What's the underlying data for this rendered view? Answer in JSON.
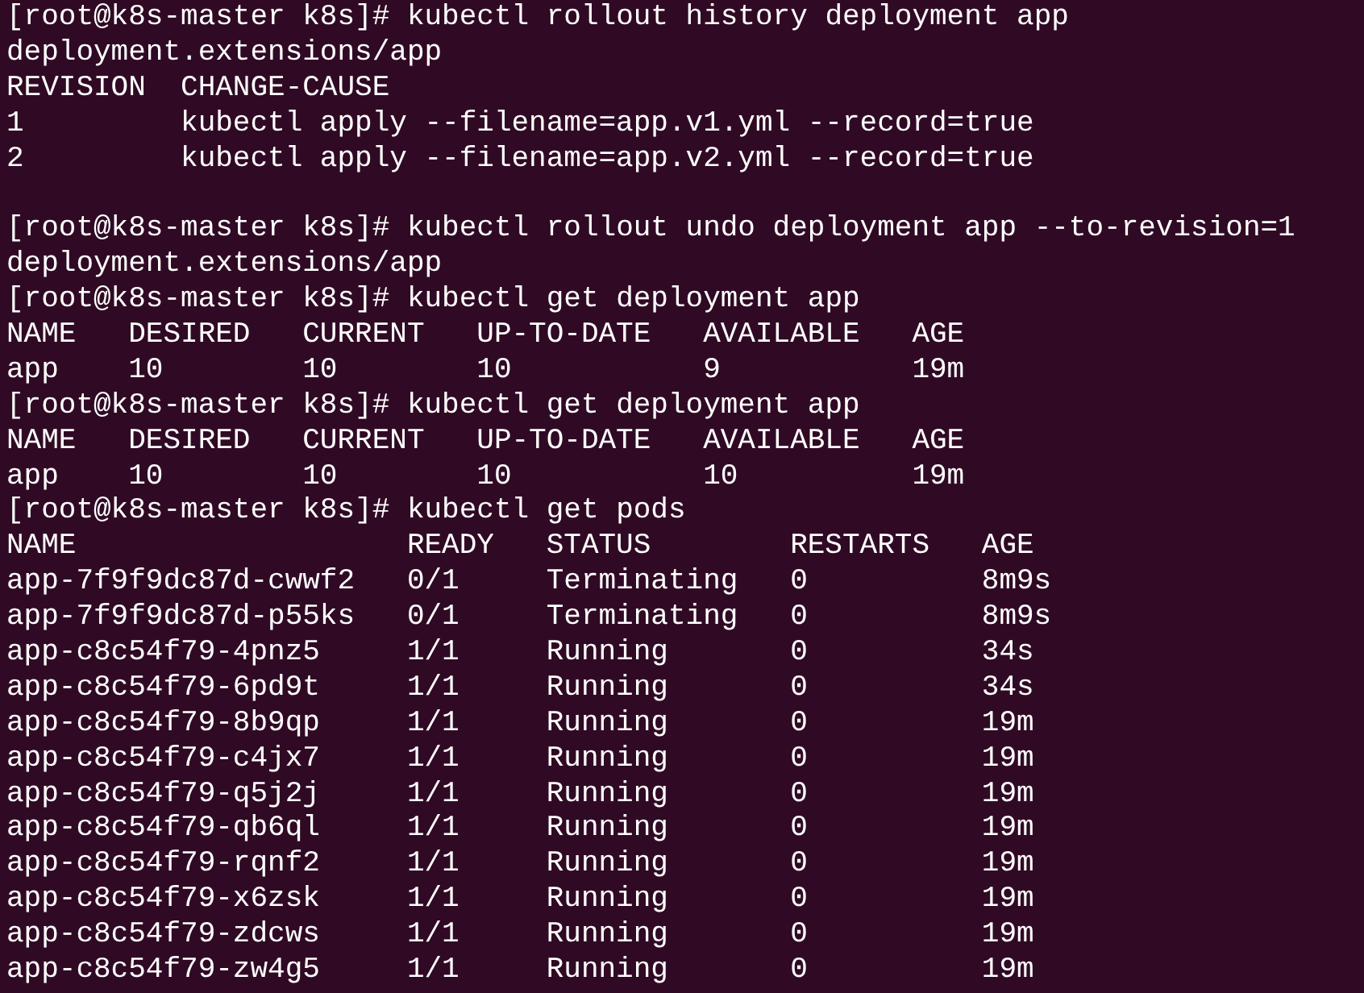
{
  "terminal": {
    "lines": [
      {
        "prompt": "[root@k8s-master k8s]#",
        "command": "kubectl rollout history deployment app"
      },
      {
        "text": "deployment.extensions/app"
      },
      {
        "text": "REVISION  CHANGE-CAUSE"
      },
      {
        "text": "1         kubectl apply --filename=app.v1.yml --record=true"
      },
      {
        "text": "2         kubectl apply --filename=app.v2.yml --record=true"
      },
      {
        "prompt": "[root@k8s-master k8s]#",
        "command": "kubectl rollout undo deployment app --to-revision=1",
        "blank_line_before": true
      },
      {
        "text": "deployment.extensions/app"
      },
      {
        "prompt": "[root@k8s-master k8s]#",
        "command": "kubectl get deployment app"
      },
      {
        "text": "NAME   DESIRED   CURRENT   UP-TO-DATE   AVAILABLE   AGE"
      },
      {
        "text": "app    10        10        10           9           19m"
      },
      {
        "prompt": "[root@k8s-master k8s]#",
        "command": "kubectl get deployment app"
      },
      {
        "text": "NAME   DESIRED   CURRENT   UP-TO-DATE   AVAILABLE   AGE"
      },
      {
        "text": "app    10        10        10           10          19m"
      },
      {
        "prompt": "[root@k8s-master k8s]#",
        "command": "kubectl get pods"
      },
      {
        "text": "NAME                   READY   STATUS        RESTARTS   AGE"
      },
      {
        "text": "app-7f9f9dc87d-cwwf2   0/1     Terminating   0          8m9s"
      },
      {
        "text": "app-7f9f9dc87d-p55ks   0/1     Terminating   0          8m9s"
      },
      {
        "text": "app-c8c54f79-4pnz5     1/1     Running       0          34s"
      },
      {
        "text": "app-c8c54f79-6pd9t     1/1     Running       0          34s"
      },
      {
        "text": "app-c8c54f79-8b9qp     1/1     Running       0          19m"
      },
      {
        "text": "app-c8c54f79-c4jx7     1/1     Running       0          19m"
      },
      {
        "text": "app-c8c54f79-q5j2j     1/1     Running       0          19m"
      },
      {
        "text": "app-c8c54f79-qb6ql     1/1     Running       0          19m"
      },
      {
        "text": "app-c8c54f79-rqnf2     1/1     Running       0          19m"
      },
      {
        "text": "app-c8c54f79-x6zsk     1/1     Running       0          19m"
      },
      {
        "text": "app-c8c54f79-zdcws     1/1     Running       0          19m"
      },
      {
        "text": "app-c8c54f79-zw4g5     1/1     Running       0          19m"
      }
    ]
  }
}
